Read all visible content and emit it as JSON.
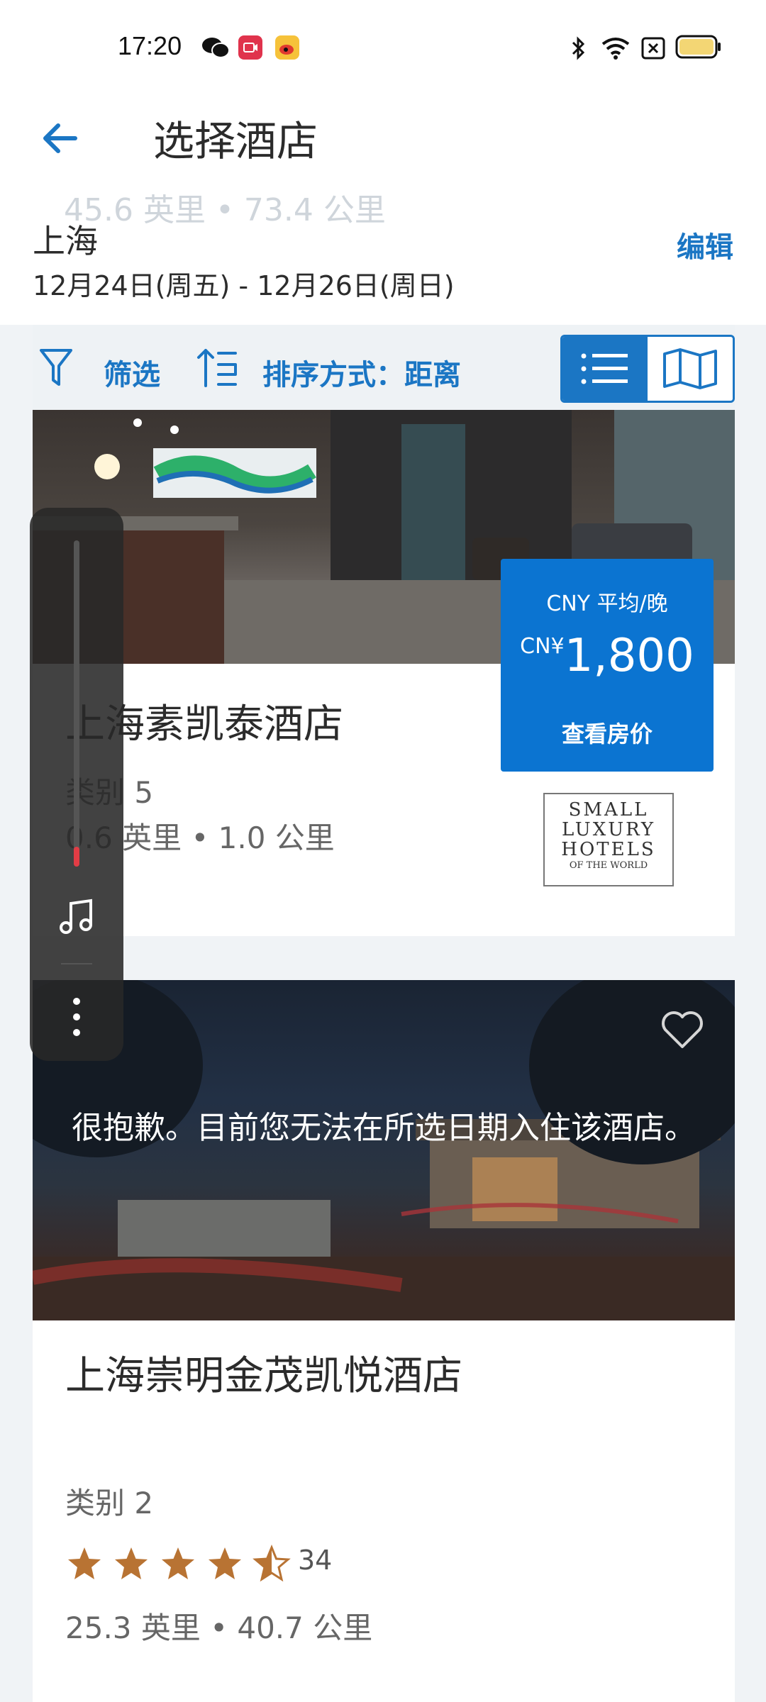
{
  "status_bar": {
    "time": "17:20"
  },
  "app_bar": {
    "title": "选择酒店"
  },
  "search": {
    "ghost_distance": "45.6 英里 • 73.4 公里",
    "city": "上海",
    "dates": "12月24日(周五) - 12月26日(周日)",
    "edit_label": "编辑"
  },
  "toolbar": {
    "filter_label": "筛选",
    "sort_label": "排序方式：距离",
    "view_options": [
      "list",
      "map"
    ],
    "selected_view": "list"
  },
  "hotels": [
    {
      "name": "上海素凯泰酒店",
      "category": "类别 5",
      "distance": "0.6 英里 • 1.0 公里",
      "price_header": "CNY 平均/晚",
      "price_currency": "CN¥",
      "price_value": "1,800",
      "view_rates_label": "查看房价",
      "brand_logo_text": [
        "SMALL",
        "LUXURY",
        "HOTELS",
        "OF THE WORLD"
      ]
    },
    {
      "name": "上海崇明金茂凯悦酒店",
      "category": "类别 2",
      "rating": 4.5,
      "review_count": "34",
      "distance": "25.3 英里 • 40.7 公里",
      "unavailable_message": "很抱歉。目前您无法在所选日期入住该酒店。"
    }
  ],
  "colors": {
    "accent": "#1b76c4",
    "price_box": "#0b74d1",
    "star": "#b87333",
    "background": "#f0f3f6"
  }
}
